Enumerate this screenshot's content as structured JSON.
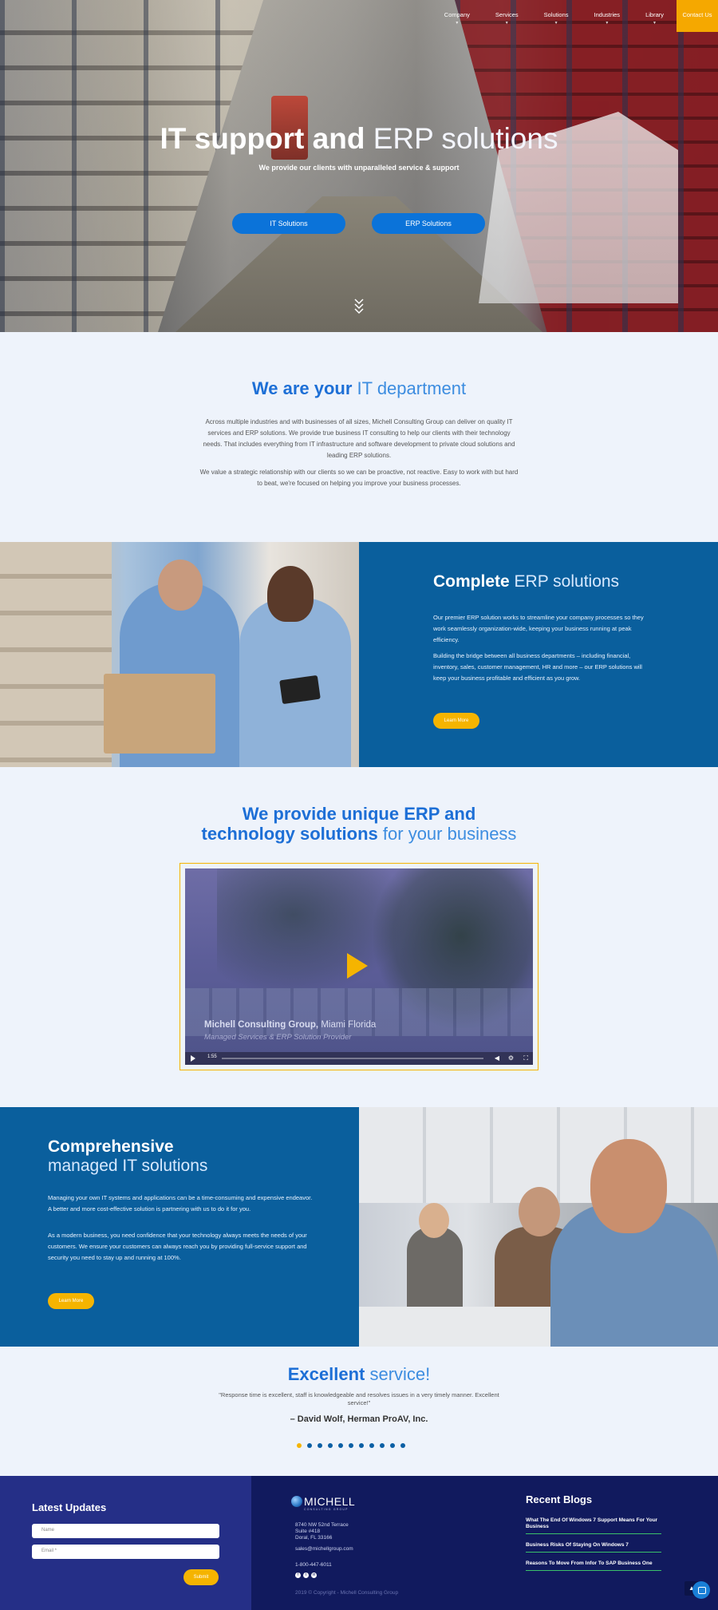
{
  "nav": {
    "items": [
      "Company",
      "Services",
      "Solutions",
      "Industries",
      "Library"
    ],
    "contact": "Contact Us"
  },
  "hero": {
    "title_bold": "IT support and",
    "title_light": "ERP solutions",
    "subtitle": "We provide our clients with unparalleled service & support",
    "btn_it": "IT Solutions",
    "btn_erp": "ERP Solutions"
  },
  "it_dept": {
    "title_bold": "We are your",
    "title_light": "IT department",
    "p1": "Across multiple industries and with businesses of all sizes, Michell Consulting Group can deliver on quality IT services and ERP solutions. We provide true business IT consulting to help our clients with their technology needs. That includes everything from IT infrastructure and software development to private cloud solutions and leading ERP solutions.",
    "p2": "We value a strategic relationship with our clients so we can be proactive, not reactive. Easy to work with but hard to beat, we're focused on helping you improve your business processes."
  },
  "erp": {
    "title_bold": "Complete",
    "title_light": "ERP solutions",
    "p1": "Our premier ERP solution works to streamline your company processes so they work seamlessly organization-wide, keeping your business running at peak efficiency.",
    "p2": "Building the bridge between all business departments – including financial, inventory, sales, customer management, HR and more – our ERP solutions will keep your business profitable and efficient as you grow.",
    "btn": "Learn More"
  },
  "unique": {
    "title_line1": "We provide unique ERP and",
    "title_bold2": "technology solutions",
    "title_light2": "for your business"
  },
  "video": {
    "caption_bold": "Michell Consulting Group,",
    "caption_light": "Miami Florida",
    "caption_sub": "Managed Services & ERP Solution Provider",
    "time": "1:55"
  },
  "managed": {
    "title_bold": "Comprehensive",
    "title_light": "managed IT solutions",
    "p1": "Managing your own IT systems and applications can be a time-consuming and expensive endeavor. A better and more cost-effective solution is partnering with us to do it for you.",
    "p2": "As a modern business, you need confidence that your technology always meets the needs of your customers. We ensure your customers can always reach you by providing full-service support and security you need to stay up and running at 100%.",
    "btn": "Learn More"
  },
  "testimonial": {
    "title_bold": "Excellent",
    "title_light": "service!",
    "quote": "\"Response time is excellent, staff is knowledgeable and resolves issues in a very timely manner. Excellent service!\"",
    "author": "– David Wolf, Herman ProAV, Inc.",
    "dot_count": 11,
    "active_dot": 0
  },
  "footer": {
    "updates_title": "Latest Updates",
    "name_placeholder": "Name",
    "email_placeholder": "Email *",
    "submit": "Submit",
    "logo_text": "MICHELL",
    "logo_sub": "CONSULTING GROUP",
    "address_line1": "8740 NW 52nd Terrace",
    "address_line2": "Suite #418",
    "address_line3": "Doral, FL 33166",
    "email": "sales@michellgroup.com",
    "phone": "1-800-447-6011",
    "copyright": "2019 © Copyright - Michell Consulting Group",
    "recent_title": "Recent Blogs",
    "blogs": [
      "What The End Of Windows 7 Support Means For Your Business",
      "Business Risks Of Staying On Windows 7",
      "Reasons To Move From Infor To SAP Business One"
    ]
  },
  "colors": {
    "brand_blue": "#1d6fd6",
    "panel_blue": "#0a5f9d",
    "accent_yellow": "#f5b400",
    "footer_dark": "#111a5e",
    "footer_mid": "#252f87"
  }
}
